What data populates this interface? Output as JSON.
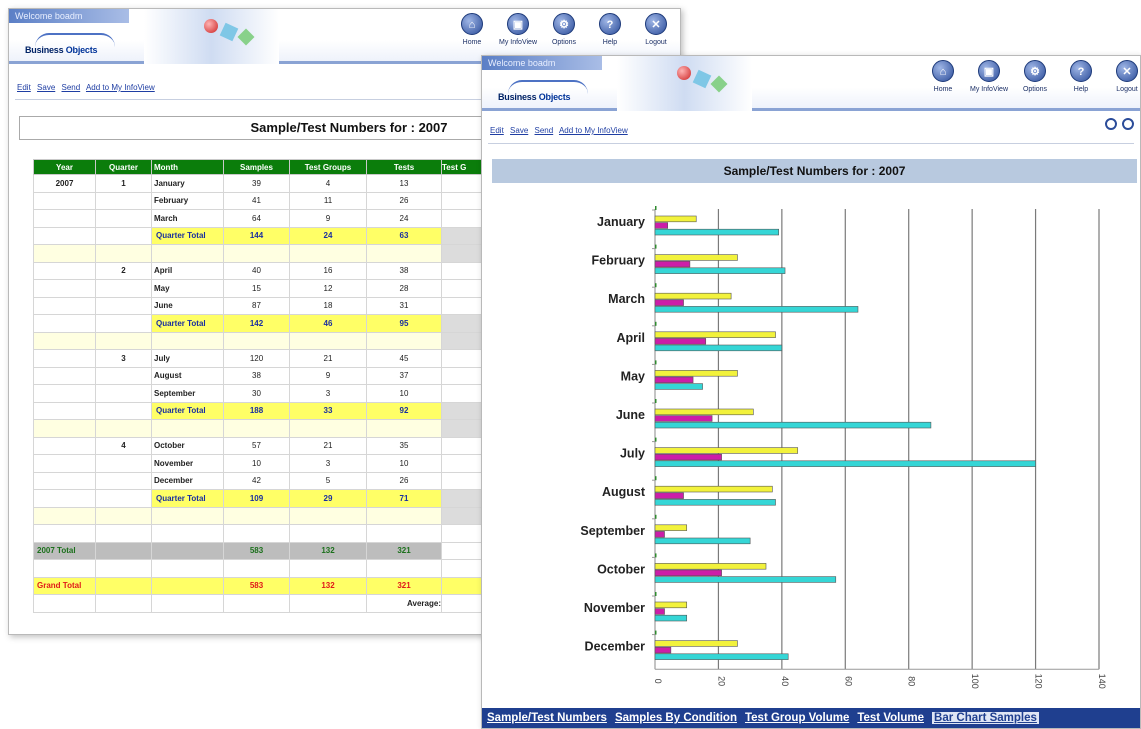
{
  "header": {
    "welcome": "Welcome boadm",
    "logo_text_1": "Business ",
    "logo_text_2": "Objects",
    "nav": [
      {
        "label": "Home",
        "glyph": "⌂"
      },
      {
        "label": "My InfoView",
        "glyph": "▣"
      },
      {
        "label": "Options",
        "glyph": "⚙"
      },
      {
        "label": "Help",
        "glyph": "?"
      },
      {
        "label": "Logout",
        "glyph": "✕"
      }
    ]
  },
  "toolbar": {
    "edit": "Edit",
    "save": "Save",
    "send": "Send",
    "add": "Add to My InfoView"
  },
  "report": {
    "title": "Sample/Test Numbers for : 2007",
    "columns": [
      "Year",
      "Quarter",
      "Month",
      "Samples",
      "Test Groups",
      "Tests",
      "Test G"
    ],
    "year": "2007",
    "quarters": [
      {
        "q": "1",
        "months": [
          [
            "January",
            "39",
            "4",
            "13"
          ],
          [
            "February",
            "41",
            "11",
            "26"
          ],
          [
            "March",
            "64",
            "9",
            "24"
          ]
        ],
        "total": [
          "144",
          "24",
          "63"
        ]
      },
      {
        "q": "2",
        "months": [
          [
            "April",
            "40",
            "16",
            "38"
          ],
          [
            "May",
            "15",
            "12",
            "28"
          ],
          [
            "June",
            "87",
            "18",
            "31"
          ]
        ],
        "total": [
          "142",
          "46",
          "95"
        ]
      },
      {
        "q": "3",
        "months": [
          [
            "July",
            "120",
            "21",
            "45"
          ],
          [
            "August",
            "38",
            "9",
            "37"
          ],
          [
            "September",
            "30",
            "3",
            "10"
          ]
        ],
        "total": [
          "188",
          "33",
          "92"
        ]
      },
      {
        "q": "4",
        "months": [
          [
            "October",
            "57",
            "21",
            "35"
          ],
          [
            "November",
            "10",
            "3",
            "10"
          ],
          [
            "December",
            "42",
            "5",
            "26"
          ]
        ],
        "total": [
          "109",
          "29",
          "71"
        ]
      }
    ],
    "quarter_total_label": "Quarter Total",
    "year_total": {
      "label": "2007 Total",
      "samples": "583",
      "groups": "132",
      "tests": "321"
    },
    "grand_total": {
      "label": "Grand Total",
      "samples": "583",
      "groups": "132",
      "tests": "321"
    },
    "average_label": "Average:"
  },
  "tabs": [
    "Sample/Test Numbers",
    "Samples By Condition",
    "Test Group Volume",
    "Test Volume",
    "Bar Chart Samples"
  ],
  "colors": {
    "yellow": "#f2f23c",
    "magenta": "#cc1ea8",
    "cyan": "#35d6d6",
    "green": "#2e8b2e"
  },
  "chart_data": {
    "type": "bar",
    "orientation": "horizontal",
    "title": "Sample/Test Numbers for : 2007",
    "categories": [
      "January",
      "February",
      "March",
      "April",
      "May",
      "June",
      "July",
      "August",
      "September",
      "October",
      "November",
      "December"
    ],
    "series": [
      {
        "color": "#f2f23c",
        "values": [
          13,
          26,
          24,
          38,
          26,
          31,
          45,
          37,
          10,
          35,
          10,
          26
        ]
      },
      {
        "color": "#cc1ea8",
        "values": [
          4,
          11,
          9,
          16,
          12,
          18,
          21,
          9,
          3,
          21,
          3,
          5
        ]
      },
      {
        "color": "#35d6d6",
        "values": [
          39,
          41,
          64,
          40,
          15,
          87,
          120,
          38,
          30,
          57,
          10,
          42
        ]
      }
    ],
    "xlim": [
      0,
      140
    ],
    "xticks": [
      "0",
      "20",
      "40",
      "60",
      "80",
      "100",
      "120",
      "140"
    ],
    "grid": true
  }
}
